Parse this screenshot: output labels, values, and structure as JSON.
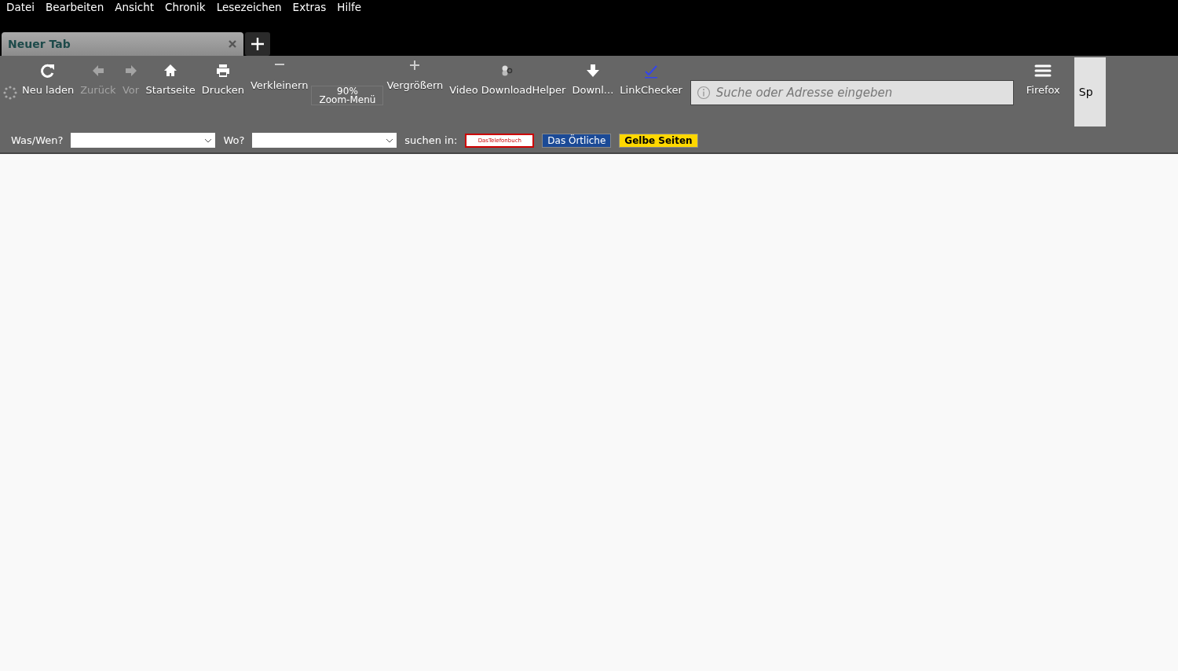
{
  "menu_bar": [
    "Datei",
    "Bearbeiten",
    "Ansicht",
    "Chronik",
    "Lesezeichen",
    "Extras",
    "Hilfe"
  ],
  "tabs": [
    {
      "label": "Neuer Tab",
      "selected": true
    }
  ],
  "toolbar": [
    {
      "kind": "reload",
      "label": "Neu laden",
      "disabled": false
    },
    {
      "kind": "back",
      "label": "Zurück",
      "disabled": true
    },
    {
      "kind": "forward",
      "label": "Vor",
      "disabled": true
    },
    {
      "kind": "home",
      "label": "Startseite",
      "disabled": false
    },
    {
      "kind": "print",
      "label": "Drucken",
      "disabled": false
    },
    {
      "kind": "zoom-out",
      "label": "Verkleinern",
      "disabled": false
    },
    {
      "kind": "zoom-reset",
      "label": "Zoom-Menü",
      "value": "90%"
    },
    {
      "kind": "zoom-in",
      "label": "Vergrößern",
      "disabled": false
    },
    {
      "kind": "video",
      "label": "Video DownloadHelper",
      "disabled": false
    },
    {
      "kind": "download",
      "label": "Downl...",
      "disabled": false
    },
    {
      "kind": "check",
      "label": "LinkChecker",
      "disabled": false
    }
  ],
  "address_bar": {
    "placeholder": "Suche oder Adresse eingeben"
  },
  "menu_button": {
    "label": "Firefox"
  },
  "side_panel": {
    "label": "Sp"
  },
  "search_bar": {
    "what_label": "Was/Wen?",
    "where_label": "Wo?",
    "search_in_label": "suchen in:",
    "services": [
      {
        "kind": "telefonbuch",
        "label": "DasTelefonbuch"
      },
      {
        "kind": "oertliche",
        "label": "Das Örtliche"
      },
      {
        "kind": "gelbe",
        "label": "Gelbe Seiten"
      }
    ]
  }
}
